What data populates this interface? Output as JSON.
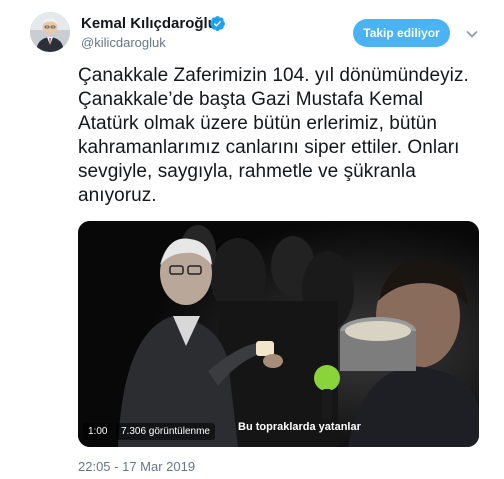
{
  "author": {
    "display_name": "Kemal Kılıçdaroğlu",
    "handle": "@kilicdarogluk",
    "verified": true,
    "avatar_icon": "profile-photo"
  },
  "actions": {
    "follow_label": "Takip ediliyor",
    "more_icon": "chevron-down-icon"
  },
  "tweet": {
    "text": "Çanakkale Zaferimizin 104. yıl dönümündeyiz. Çanakkale’de başta Gazi Mustafa Kemal Atatürk olmak üzere bütün erlerimiz, bütün kahramanlarımız canlarını siper ettiler. Onları sevgiyle, saygıyla, rahmetle ve şükranla anıyoruz.",
    "timestamp": "22:05 - 17 Mar 2019"
  },
  "video": {
    "subtitle": "Bu topraklarda yatanlar",
    "duration": "1:00",
    "views": "7.306 görüntülenme"
  },
  "colors": {
    "follow_button": "#4ab3f4",
    "verified_badge": "#1da1f2",
    "secondary_text": "#657786"
  }
}
